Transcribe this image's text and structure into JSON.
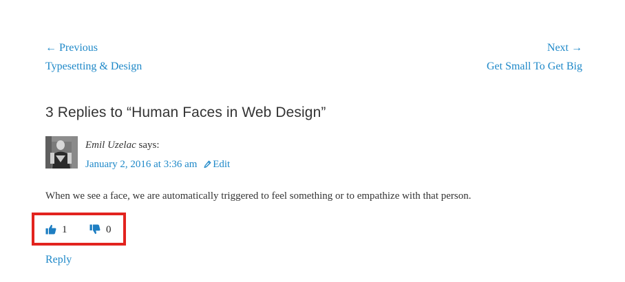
{
  "post_navigation": {
    "previous": {
      "meta": "← Previous",
      "title": "Typesetting & Design"
    },
    "next": {
      "meta": "Next →",
      "title": "Get Small To Get Big"
    }
  },
  "comments": {
    "title": "3 Replies to “Human Faces in Web Design”",
    "items": [
      {
        "avatar_icon": "author-avatar-icon",
        "author": "Emil Uzelac",
        "says": "says:",
        "date": "January 2, 2016 at 3:36 am",
        "edit_label": "Edit",
        "edit_icon": "pencil-icon",
        "text": "When we see a face, we are automatically triggered to feel something or to empathize with that person.",
        "votes": {
          "up_icon": "thumbs-up-icon",
          "up_count": "1",
          "down_icon": "thumbs-down-icon",
          "down_count": "0"
        },
        "reply_label": "Reply"
      }
    ]
  },
  "colors": {
    "link": "#1e88c8",
    "text": "#333333",
    "highlight_border": "#e2231e"
  }
}
